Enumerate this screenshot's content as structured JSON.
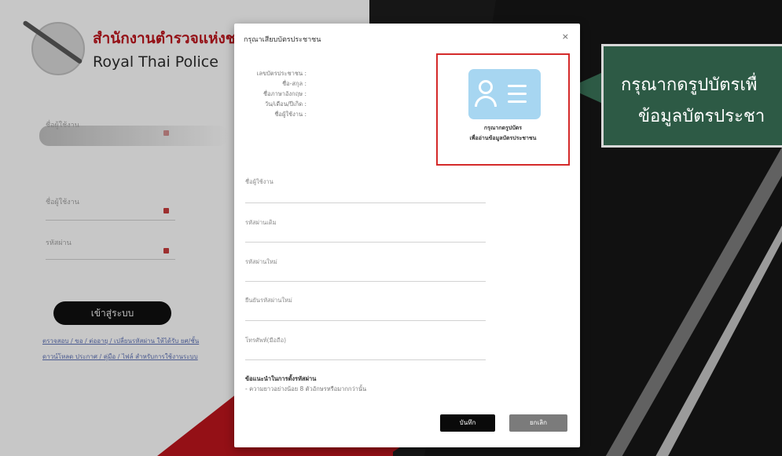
{
  "background": {
    "org_name_th": "สำนักงานตำรวจแห่งชาติ",
    "org_name_en": "Royal Thai Police",
    "labels": [
      "ชื่อผู้ใช้งาน",
      "ชื่อผู้ใช้งาน",
      "รหัสผ่าน"
    ],
    "login_button": "เข้าสู่ระบบ",
    "links": [
      "ตรวจสอบ / ขอ / ต่ออายุ / เปลี่ยนรหัสผ่าน ให้ได้รับ ยศ/ชั้น",
      "ดาวน์โหลด ประกาศ / คู่มือ / ไฟล์ สำหรับการใช้งานระบบ"
    ]
  },
  "modal": {
    "title": "กรุณาเสียบบัตรประชาชน",
    "close": "×",
    "info_labels": [
      "เลขบัตรประชาชน :",
      "ชื่อ-สกุล :",
      "ชื่อภาษาอังกฤษ :",
      "วัน/เดือน/ปีเกิด :",
      "ชื่อผู้ใช้งาน :"
    ],
    "card_caption_1": "กรุณากดรูปบัตร",
    "card_caption_2": "เพื่ออ่านข้อมูลบัตรประชาชน",
    "fields": [
      "ชื่อผู้ใช้งาน",
      "รหัสผ่านเดิม",
      "รหัสผ่านใหม่",
      "ยืนยันรหัสผ่านใหม่",
      "โทรศัพท์(มือถือ)"
    ],
    "rule_title": "ข้อแนะนำในการตั้งรหัสผ่าน",
    "rule_text": "- ความยาวอย่างน้อย 8 ตัวอักษรหรือมากกว่านั้น",
    "save_button": "บันทึก",
    "cancel_button": "ยกเลิก"
  },
  "callout": {
    "line1": "กรุณากดรูปบัตรเพื่",
    "line2": "ข้อมูลบัตรประชา"
  },
  "colors": {
    "brand_red": "#b5141b",
    "callout_green": "#2d5a45",
    "highlight_red": "#d42a2a",
    "card_blue": "#a7d6f1"
  }
}
